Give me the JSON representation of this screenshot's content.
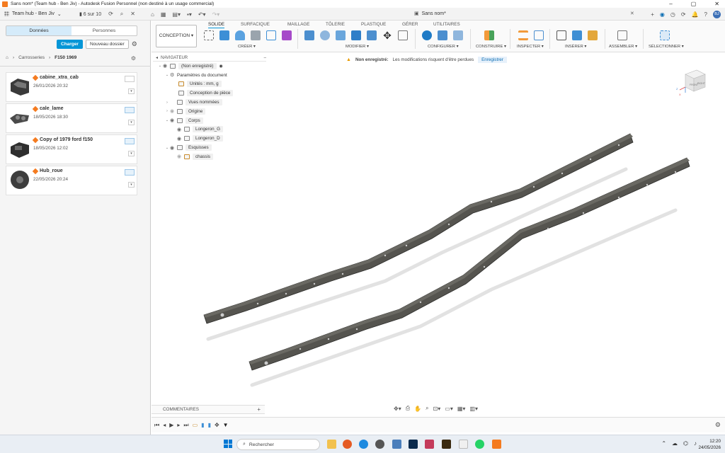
{
  "window": {
    "title": "Sans nom* (Team hub - Ben Jiv) - Autodesk Fusion Personnel (non destiné à un usage commercial)"
  },
  "topbar": {
    "hub_name": "Team hub - Ben Jiv",
    "pager": "6 sur 10",
    "doc_tab": "Sans nom*"
  },
  "avatar_initials": "BJ",
  "left_panel": {
    "tabs": [
      "Données",
      "Personnes"
    ],
    "active_tab": "Données",
    "upload_label": "Charger",
    "new_folder_label": "Nouveau dossier",
    "breadcrumb": [
      "Carrosseries",
      "F150 1969"
    ],
    "files": [
      {
        "name": "cabine_xtra_cab",
        "date": "26/01/2026 20:32",
        "ctrl": "grey"
      },
      {
        "name": "cale_lame",
        "date": "18/05/2026 18:30",
        "ctrl": "blue"
      },
      {
        "name": "Copy of 1979 ford f150",
        "date": "18/05/2026 12:02",
        "ctrl": "blue"
      },
      {
        "name": "Hub_roue",
        "date": "22/05/2026 20:24",
        "ctrl": "blue"
      }
    ]
  },
  "ribbon": {
    "workspace": "CONCEPTION",
    "tabs": [
      "SOLIDE",
      "SURFACIQUE",
      "MAILLAGE",
      "TÔLERIE",
      "PLASTIQUE",
      "GÉRER",
      "UTILITAIRES"
    ],
    "active_tab": "SOLIDE",
    "groups": [
      "CRÉER",
      "MODIFIER",
      "CONFIGURER",
      "CONSTRUIRE",
      "INSPECTER",
      "INSÉRER",
      "ASSEMBLER",
      "SÉLECTIONNER"
    ]
  },
  "navigator": {
    "title": "NAVIGATEUR",
    "document": "(Non enregistré)",
    "doc_settings": "Paramètres du document",
    "units": "Unités : mm, g",
    "design_mode": "Conception de pièce",
    "named_views": "Vues nommées",
    "origin": "Origine",
    "bodies": "Corps",
    "body_items": [
      "Longeron_G",
      "Longeron_D"
    ],
    "sketches": "Esquisses",
    "sketch_items": [
      "chassis"
    ]
  },
  "warning": {
    "label": "Non enregistré:",
    "message": "Les modifications risquent d'être perdues",
    "action": "Enregistrer"
  },
  "viewcube": {
    "front": "FRONT",
    "right": "RIGHT",
    "axis_x": "X",
    "axis_y": "Y",
    "axis_z": "Z"
  },
  "comments": {
    "label": "COMMENTAIRES"
  },
  "taskbar": {
    "search_placeholder": "Rechercher",
    "time": "12:20",
    "date": "24/05/2026"
  },
  "colors": {
    "accent": "#0696d7",
    "fusion_orange": "#f47b20",
    "rail": "#55544f"
  }
}
